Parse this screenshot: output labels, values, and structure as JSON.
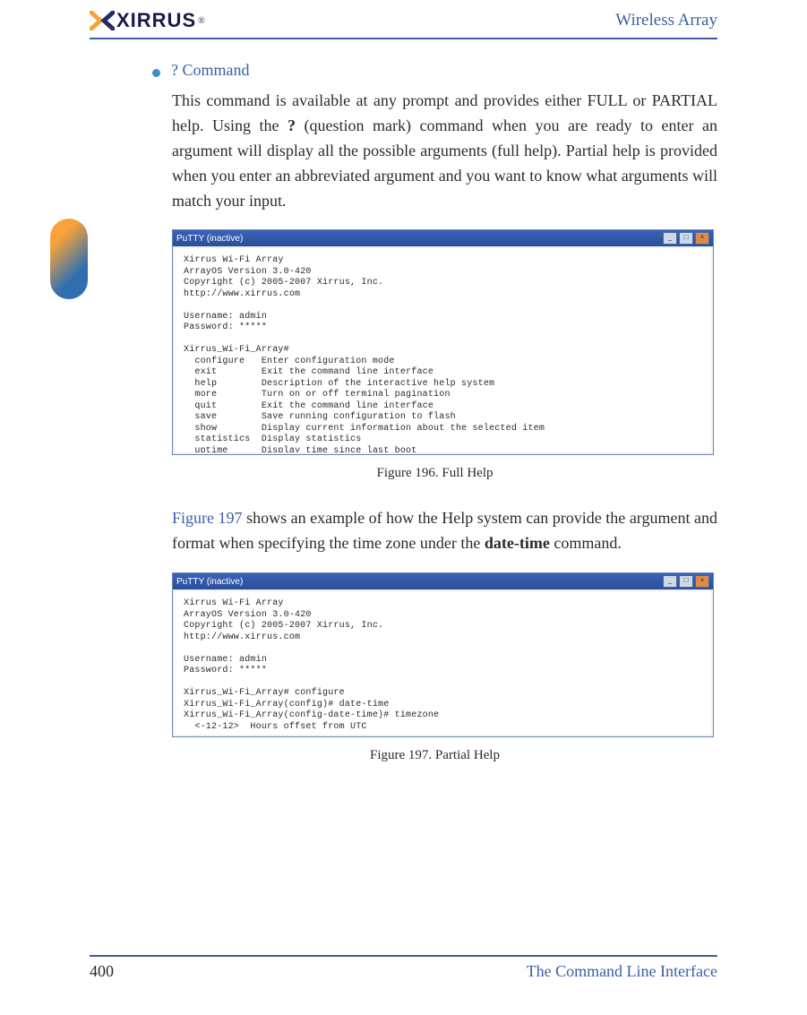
{
  "header": {
    "logo_text": "XIRRUS",
    "logo_reg": "®",
    "doc_title": "Wireless Array"
  },
  "section": {
    "heading": "? Command",
    "para1_a": "This command is available at any prompt and provides either FULL or PARTIAL help. Using the ",
    "para1_bold": "?",
    "para1_b": " (question mark) command when you are ready to enter an argument will display all the possible arguments (full help). Partial help is provided when you enter an abbreviated argument and you want to know what arguments will match your input.",
    "para2_link": "Figure 197",
    "para2_a": "  shows an example of how the Help system can provide the argument and format when specifying the time zone under the ",
    "para2_bold": "date-time",
    "para2_b": " command."
  },
  "terminal1": {
    "title": "PuTTY (inactive)",
    "btn_min": "_",
    "btn_max": "□",
    "btn_close": "×",
    "body": "Xirrus Wi-Fi Array\nArrayOS Version 3.0-420\nCopyright (c) 2005-2007 Xirrus, Inc.\nhttp://www.xirrus.com\n\nUsername: admin\nPassword: *****\n\nXirrus_Wi-Fi_Array#\n  configure   Enter configuration mode\n  exit        Exit the command line interface\n  help        Description of the interactive help system\n  more        Turn on or off terminal pagination\n  quit        Exit the command line interface\n  save        Save running configuration to flash\n  show        Display current information about the selected item\n  statistics  Display statistics\n  uptime      Display time since last boot\n\nXirrus_Wi-Fi_Array#"
  },
  "fig1_caption": "Figure 196. Full Help",
  "terminal2": {
    "title": "PuTTY (inactive)",
    "btn_min": "_",
    "btn_max": "□",
    "btn_close": "×",
    "body": "Xirrus Wi-Fi Array\nArrayOS Version 3.0-420\nCopyright (c) 2005-2007 Xirrus, Inc.\nhttp://www.xirrus.com\n\nUsername: admin\nPassword: *****\n\nXirrus_Wi-Fi_Array# configure\nXirrus_Wi-Fi_Array(config)# date-time\nXirrus_Wi-Fi_Array(config-date-time)# timezone\n  <-12-12>  Hours offset from UTC\n\nXirrus_Wi-Fi_Array(config-date-time)# timezone"
  },
  "fig2_caption": "Figure 197. Partial Help",
  "footer": {
    "page_number": "400",
    "section_title": "The Command Line Interface"
  }
}
